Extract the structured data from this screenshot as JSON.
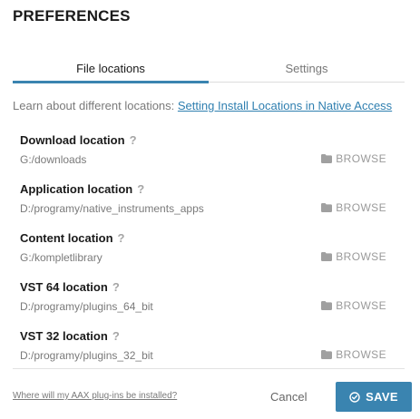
{
  "dialog": {
    "title": "PREFERENCES"
  },
  "tabs": [
    {
      "label": "File locations",
      "active": true
    },
    {
      "label": "Settings",
      "active": false
    }
  ],
  "learn": {
    "text": "Learn about different locations: ",
    "link_label": "Setting Install Locations in Native Access"
  },
  "locations": [
    {
      "label": "Download location",
      "help": "?",
      "path": "G:/downloads",
      "browse_label": "BROWSE"
    },
    {
      "label": "Application location",
      "help": "?",
      "path": "D:/programy/native_instruments_apps",
      "browse_label": "BROWSE"
    },
    {
      "label": "Content location",
      "help": "?",
      "path": "G:/kompletlibrary",
      "browse_label": "BROWSE"
    },
    {
      "label": "VST 64 location",
      "help": "?",
      "path": "D:/programy/plugins_64_bit",
      "browse_label": "BROWSE"
    },
    {
      "label": "VST 32 location",
      "help": "?",
      "path": "D:/programy/plugins_32_bit",
      "browse_label": "BROWSE"
    }
  ],
  "footer": {
    "aax_link": "Where will my AAX plug-ins be installed?",
    "cancel_label": "Cancel",
    "save_label": "SAVE"
  },
  "icons": {
    "folder": "folder-icon",
    "save": "check-circle-icon"
  },
  "colors": {
    "accent": "#3a84b0",
    "link": "#2f7fb0"
  }
}
